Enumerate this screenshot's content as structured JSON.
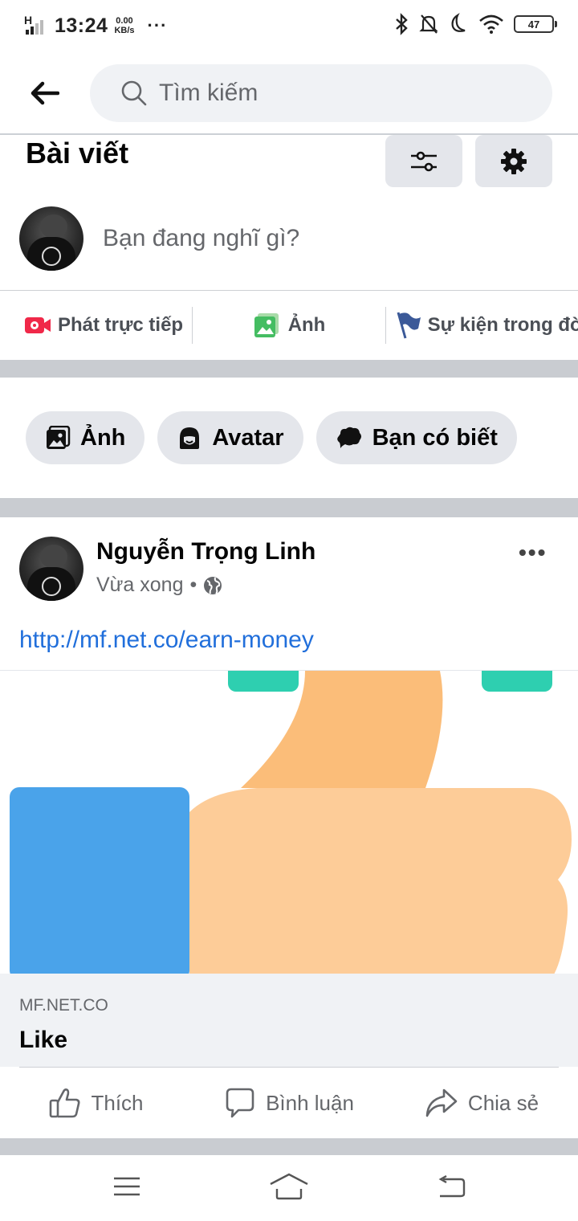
{
  "status_bar": {
    "network": "H",
    "time": "13:24",
    "speed_value": "0.00",
    "speed_unit": "KB/s",
    "more": "···",
    "battery": "47"
  },
  "search": {
    "placeholder": "Tìm kiếm"
  },
  "section": {
    "title": "Bài viết"
  },
  "composer": {
    "placeholder": "Bạn đang nghĩ gì?"
  },
  "quick_actions": [
    {
      "label": "Phát trực tiếp",
      "icon": "live-video-icon",
      "color": "#f02849"
    },
    {
      "label": "Ảnh",
      "icon": "photo-icon",
      "color": "#45bd62"
    },
    {
      "label": "Sự kiện trong đời",
      "icon": "flag-icon",
      "color": "#3b5998"
    }
  ],
  "chips": [
    {
      "label": "Ảnh",
      "icon": "photo-icon"
    },
    {
      "label": "Avatar",
      "icon": "avatar-face-icon"
    },
    {
      "label": "Bạn có biết",
      "icon": "speech-bubble-icon"
    }
  ],
  "post": {
    "author": "Nguyễn Trọng Linh",
    "time": "Vừa xong",
    "separator": "•",
    "privacy_icon": "globe-icon",
    "link_text": "http://mf.net.co/earn-money",
    "preview_domain": "MF.NET.CO",
    "preview_title": "Like",
    "actions": [
      {
        "label": "Thích",
        "icon": "thumbs-up-icon"
      },
      {
        "label": "Bình luận",
        "icon": "comment-icon"
      },
      {
        "label": "Chia sẻ",
        "icon": "share-icon"
      }
    ]
  },
  "colors": {
    "link": "#216fdb",
    "secondary_text": "#65676b",
    "divider_band": "#c9ccd1",
    "thumb_blue": "#4aa3ea",
    "thumb_skin": "#fdcc98",
    "thumb_skin_dark": "#fbbd79",
    "thumb_teal": "#2ecfb0"
  }
}
